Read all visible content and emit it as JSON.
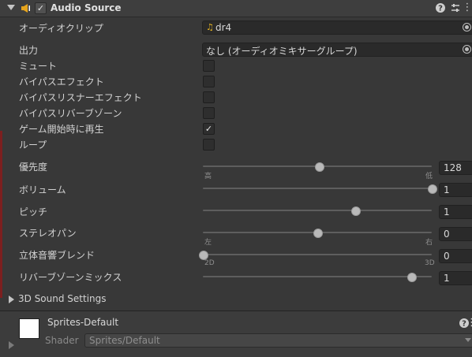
{
  "component": {
    "title": "Audio Source",
    "enabled_mark": "✓",
    "icons": [
      "help-icon",
      "presets-icon",
      "more-icon"
    ],
    "icon_glyphs": {
      "help": "?",
      "presets": "⇵",
      "more": "⋮"
    }
  },
  "fields": {
    "audio_clip": {
      "label": "オーディオクリップ",
      "value": "dr4"
    },
    "output": {
      "label": "出力",
      "value": "なし (オーディオミキサーグループ)"
    }
  },
  "toggles": [
    {
      "label": "ミュート",
      "checked": false,
      "mark": ""
    },
    {
      "label": "バイパスエフェクト",
      "checked": false,
      "mark": ""
    },
    {
      "label": "バイパスリスナーエフェクト",
      "checked": false,
      "mark": ""
    },
    {
      "label": "バイパスリバーブゾーン",
      "checked": false,
      "mark": ""
    },
    {
      "label": "ゲーム開始時に再生",
      "checked": true,
      "mark": "✓"
    },
    {
      "label": "ループ",
      "checked": false,
      "mark": ""
    }
  ],
  "sliders": [
    {
      "label": "優先度",
      "value": "128",
      "fraction": 0.508,
      "min_label": "高",
      "max_label": "低"
    },
    {
      "label": "ボリューム",
      "value": "1",
      "fraction": 1.0,
      "min_label": "",
      "max_label": ""
    },
    {
      "label": "ピッチ",
      "value": "1",
      "fraction": 0.667,
      "min_label": "",
      "max_label": ""
    },
    {
      "label": "ステレオパン",
      "value": "0",
      "fraction": 0.5,
      "min_label": "左",
      "max_label": "右"
    },
    {
      "label": "立体音響ブレンド",
      "value": "0",
      "fraction": 0.0,
      "min_label": "2D",
      "max_label": "3D"
    },
    {
      "label": "リバーブゾーンミックス",
      "value": "1",
      "fraction": 0.909,
      "min_label": "",
      "max_label": ""
    }
  ],
  "sound_settings": {
    "label": "3D Sound Settings"
  },
  "material": {
    "title": "Sprites-Default",
    "shader_label": "Shader",
    "shader_value": "Sprites/Default"
  },
  "colors": {
    "panel": "#383838",
    "accent_note": "#e6b422"
  }
}
